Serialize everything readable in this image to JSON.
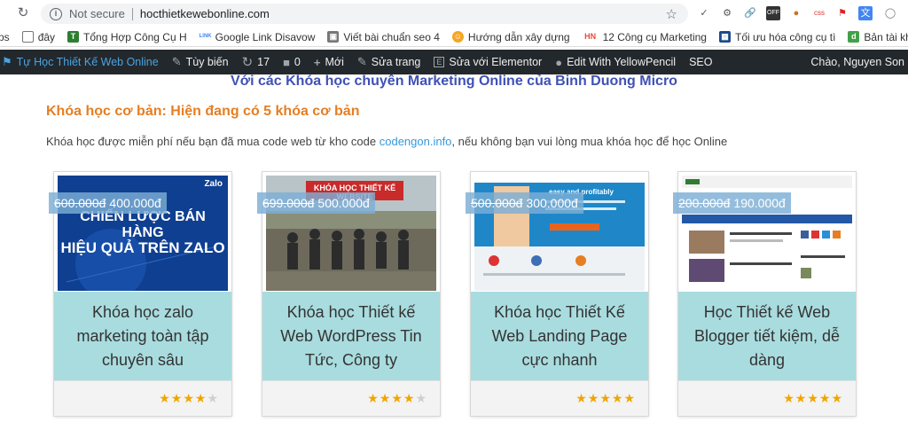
{
  "browser": {
    "not_secure": "Not secure",
    "url": "hocthietkewebonline.com"
  },
  "bookmarks": [
    {
      "label": "ps",
      "icon": "apps-icon"
    },
    {
      "label": "đây",
      "icon": "page-icon"
    },
    {
      "label": "Tổng Hợp Công Cụ H",
      "icon": "tool-icon"
    },
    {
      "label": "Google Link Disavow",
      "icon": "google-icon"
    },
    {
      "label": "Viết bài chuẩn seo 4",
      "icon": "doc-icon"
    },
    {
      "label": "Hướng dẫn xây dựng",
      "icon": "chat-icon"
    },
    {
      "label": "12 Công cụ Marketing",
      "icon": "hn-icon"
    },
    {
      "label": "Tối ưu hóa công cụ tì",
      "icon": "grid-icon"
    },
    {
      "label": "Bản tài khoản ahrefs",
      "icon": "d-icon"
    }
  ],
  "wpbar": {
    "site": "Tự Học Thiết Kế Web Online",
    "customize": "Tùy biến",
    "updates": "17",
    "comments": "0",
    "new": "Mới",
    "edit": "Sửa trang",
    "elementor": "Sửa với Elementor",
    "yellowpencil": "Edit With YellowPencil",
    "seo": "SEO",
    "greeting": "Chào, Nguyen Son"
  },
  "headline": "Với các Khóa học chuyên Marketing Online của Binh Duong Micro",
  "section_title": "Khóa học cơ bản: Hiện đang có 5 khóa cơ bản",
  "intro": {
    "before": "Khóa  học được miễn phí nếu bạn đã mua code web từ kho code ",
    "link": "codengon.info",
    "after": ", nếu không bạn vui lòng mua khóa học để học Online"
  },
  "colors": {
    "accent_orange": "#e67e22",
    "headline_blue": "#3f51b5",
    "card_body": "#a9dcdf",
    "star": "#f0a500"
  },
  "courses": [
    {
      "title": "Khóa học zalo marketing toàn tập chuyên sâu",
      "old_price": "600.000đ",
      "new_price": "400.000đ",
      "rating": 4,
      "thumb_text": [
        "CHIẾN LƯỢC BÁN HÀNG",
        "HIỆU QUẢ TRÊN ZALO"
      ],
      "thumb_brand": "Zalo"
    },
    {
      "title": "Khóa học Thiết kế Web WordPress Tin Tức, Công ty",
      "old_price": "699.000đ",
      "new_price": "500.000đ",
      "rating": 4,
      "thumb_text": [
        "KHÓA HỌC THIẾT KẾ WEBSITE"
      ]
    },
    {
      "title": "Khóa học Thiết Kế Web Landing Page cực nhanh",
      "old_price": "500.000đ",
      "new_price": "300.000đ",
      "rating": 5,
      "thumb_text": [
        "easy and profitably"
      ]
    },
    {
      "title": "Học Thiết kế Web Blogger tiết kiệm, dễ dàng",
      "old_price": "200.000đ",
      "new_price": "190.000đ",
      "rating": 5,
      "thumb_text": []
    }
  ]
}
